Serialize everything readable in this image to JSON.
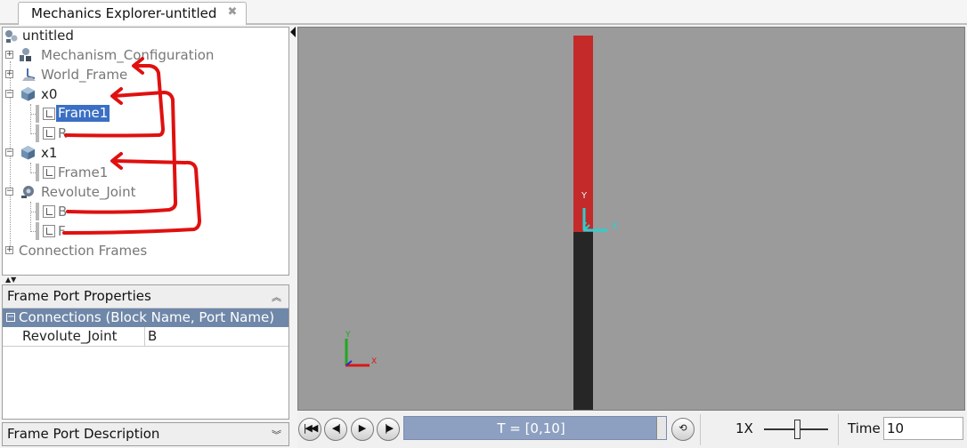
{
  "tab": {
    "title": "Mechanics Explorer-untitled"
  },
  "tree": {
    "root": "untitled",
    "mechanism_configuration": "Mechanism_Configuration",
    "world_frame": "World_Frame",
    "x0": {
      "label": "x0",
      "children": [
        "Frame1",
        "R"
      ]
    },
    "x1": {
      "label": "x1",
      "children": [
        "Frame1"
      ]
    },
    "revolute_joint": {
      "label": "Revolute_Joint",
      "children": [
        "B",
        "F"
      ]
    },
    "connection_frames": "Connection Frames"
  },
  "properties": {
    "title": "Frame Port Properties",
    "group_header": "Connections (Block Name, Port Name)",
    "rows": [
      {
        "block": "Revolute_Joint",
        "port": "B"
      }
    ]
  },
  "description": {
    "title": "Frame Port Description"
  },
  "viewport": {
    "frame_labels": {
      "y": "Y",
      "x": "X",
      "z": "Z"
    },
    "colors": {
      "background": "#9b9b9b",
      "link_top": "#c42a2a",
      "link_bottom": "#262626",
      "frame_axes": "#2ad0d0",
      "annotation": "#e01010"
    }
  },
  "toolbar": {
    "timeline_text": "T = [0,10]",
    "speed": "1X",
    "time_label": "Time",
    "time_value": "10"
  }
}
